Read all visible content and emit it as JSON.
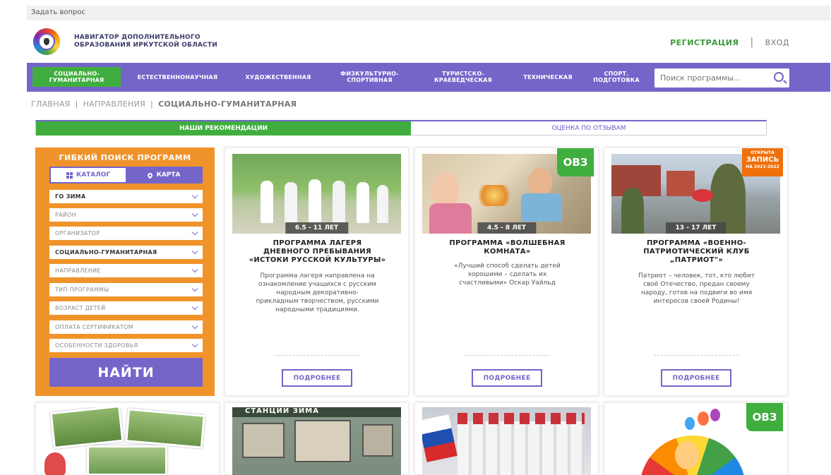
{
  "topbar": {
    "ask": "Задать вопрос"
  },
  "header": {
    "brand_line1": "НАВИГАТОР ДОПОЛНИТЕЛЬНОГО",
    "brand_line2": "ОБРАЗОВАНИЯ ИРКУТСКОЙ ОБЛАСТИ",
    "register": "РЕГИСТРАЦИЯ",
    "separator": "|",
    "login": "ВХОД"
  },
  "nav": {
    "items": [
      {
        "line1": "СОЦИАЛЬНО-",
        "line2": "ГУМАНИТАРНАЯ"
      },
      {
        "line1": "ЕСТЕСТВЕННОНАУЧНАЯ",
        "line2": ""
      },
      {
        "line1": "ХУДОЖЕСТВЕННАЯ",
        "line2": ""
      },
      {
        "line1": "ФИЗКУЛЬТУРНО-",
        "line2": "СПОРТИВНАЯ"
      },
      {
        "line1": "ТУРИСТСКО-",
        "line2": "КРАЕВЕДЧЕСКАЯ"
      },
      {
        "line1": "ТЕХНИЧЕСКАЯ",
        "line2": ""
      },
      {
        "line1": "СПОРТ.",
        "line2": "ПОДГОТОВКА"
      }
    ],
    "search_placeholder": "Поиск программы..."
  },
  "breadcrumb": {
    "home": "ГЛАВНАЯ",
    "sep": "|",
    "section": "НАПРАВЛЕНИЯ",
    "current": "СОЦИАЛЬНО-ГУМАНИТАРНАЯ"
  },
  "tabs": {
    "recommendations": "НАШИ РЕКОМЕНДАЦИИ",
    "reviews": "ОЦЕНКА ПО ОТЗЫВАМ"
  },
  "filter": {
    "title": "ГИБКИЙ ПОИСК ПРОГРАММ",
    "catalog": "КАТАЛОГ",
    "map": "КАРТА",
    "selects": [
      "ГО ЗИМА",
      "РАЙОН",
      "ОРГАНИЗАТОР",
      "СОЦИАЛЬНО-ГУМАНИТАРНАЯ",
      "НАПРАВЛЕНИЕ",
      "ТИП ПРОГРАММЫ",
      "ВОЗРАСТ ДЕТЕЙ",
      "ОПЛАТА СЕРТИФИКАТОМ",
      "ОСОБЕННОСТИ ЗДОРОВЬЯ"
    ],
    "find": "НАЙТИ"
  },
  "cards": [
    {
      "age": "6.5 - 11 ЛЕТ",
      "title_l1": "ПРОГРАММА ЛАГЕРЯ",
      "title_l2": "ДНЕВНОГО ПРЕБЫВАНИЯ",
      "title_l3": "«ИСТОКИ РУССКОЙ КУЛЬТУРЫ»",
      "desc_l1": "Программа лагеря направлена на",
      "desc_l2": "ознакомление учащихся с русским",
      "desc_l3": "народным декоративно-",
      "desc_l4": "прикладным творчеством, русскими",
      "desc_l5": "народными традициями.",
      "more": "ПОДРОБНЕЕ"
    },
    {
      "badge": "ОВЗ",
      "age": "4.5 - 8 ЛЕТ",
      "title_l1": "ПРОГРАММА «ВОЛШЕБНАЯ",
      "title_l2": "КОМНАТА»",
      "title_l3": "",
      "desc_l1": "«Лучший способ сделать детей",
      "desc_l2": "хорошими – сделать их",
      "desc_l3": "счастливыми» Оскар Уайльд",
      "desc_l4": "",
      "desc_l5": "",
      "more": "ПОДРОБНЕЕ"
    },
    {
      "open_l1": "ОТКРЫТА",
      "open_l2": "ЗАПИСЬ",
      "open_l3": "НА 2021-2022",
      "age": "13 - 17 ЛЕТ",
      "title_l1": "ПРОГРАММА «ВОЕННО-",
      "title_l2": "ПАТРИОТИЧЕСКИЙ КЛУБ",
      "title_l3": "„ПАТРИОТ\"»",
      "desc_l1": "Патриот – человек, тот, кто любит",
      "desc_l2": "своё Отечество, предан своему",
      "desc_l3": "народу, готов на подвиги во имя",
      "desc_l4": "интересов своей Родины!",
      "desc_l5": "",
      "more": "ПОДРОБНЕЕ"
    }
  ],
  "row2": {
    "sign_text": "СТАНЦИИ  ЗИМА",
    "badge": "ОВЗ"
  },
  "colors": {
    "purple": "#7466c9",
    "green": "#3fae3f",
    "orange": "#f0932b"
  }
}
